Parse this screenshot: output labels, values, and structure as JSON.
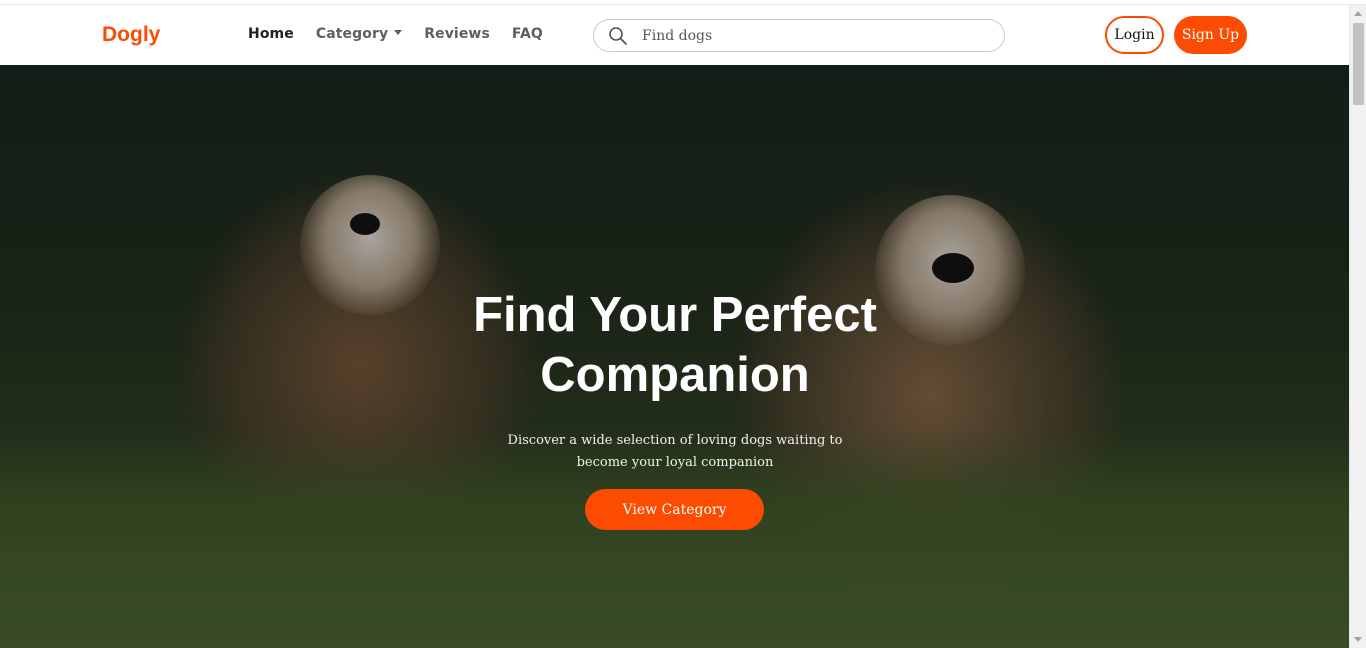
{
  "brand": {
    "name": "Dogly",
    "color": "#fc4c02"
  },
  "nav": {
    "items": [
      {
        "label": "Home",
        "active": true
      },
      {
        "label": "Category",
        "dropdown": true
      },
      {
        "label": "Reviews"
      },
      {
        "label": "FAQ"
      }
    ]
  },
  "search": {
    "placeholder": "Find dogs",
    "value": "",
    "icon": "search-icon"
  },
  "auth": {
    "login_label": "Login",
    "signup_label": "Sign Up"
  },
  "hero": {
    "title": "Find Your Perfect Companion",
    "subtitle": "Discover a wide selection of loving dogs waiting to become your loyal companion",
    "cta_label": "View Category",
    "background": "two-dogs-in-meadow"
  },
  "colors": {
    "accent": "#fc4c02",
    "text_dark": "#222222",
    "text_muted": "#5f5f5f"
  }
}
